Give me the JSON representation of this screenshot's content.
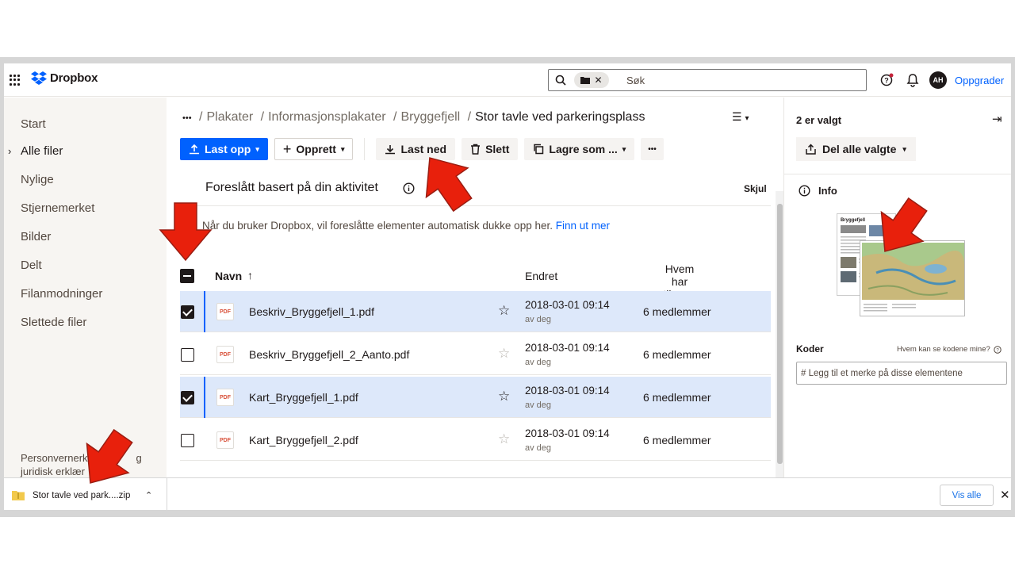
{
  "app": {
    "name": "Dropbox"
  },
  "header": {
    "search_placeholder": "Søk",
    "avatar_initials": "AH",
    "upgrade_label": "Oppgrader"
  },
  "sidebar": {
    "items": [
      {
        "label": "Start"
      },
      {
        "label": "Alle filer",
        "active": true
      },
      {
        "label": "Nylige"
      },
      {
        "label": "Stjernemerket"
      },
      {
        "label": "Bilder"
      },
      {
        "label": "Delt"
      },
      {
        "label": "Filanmodninger"
      },
      {
        "label": "Slettede filer"
      }
    ],
    "legal_line1": "Personvernerkl",
    "legal_line1_tail": "g",
    "legal_line2": "juridisk erklær"
  },
  "breadcrumb": {
    "more": "•••",
    "parts": [
      "Plakater",
      "Informasjonsplakater",
      "Bryggefjell"
    ],
    "current": "Stor tavle ved parkeringsplass"
  },
  "toolbar": {
    "upload_label": "Last opp",
    "create_label": "Opprett",
    "download_label": "Last ned",
    "delete_label": "Slett",
    "save_as_label": "Lagre som ...",
    "more_label": "•••"
  },
  "suggestions": {
    "title": "Foreslått basert på din aktivitet",
    "hide_label": "Skjul",
    "text": "Når du bruker Dropbox, vil foreslåtte elementer automatisk dukke opp her.",
    "link": "Finn ut mer"
  },
  "table": {
    "columns": {
      "name": "Navn",
      "modified": "Endret",
      "access_line1": "Hvem har",
      "access_line2": "tilgang"
    },
    "rows": [
      {
        "name": "Beskriv_Bryggefjell_1.pdf",
        "modified": "2018-03-01 09:14",
        "by": "av deg",
        "members": "6 medlemmer",
        "selected": true,
        "starred": true
      },
      {
        "name": "Beskriv_Bryggefjell_2_Aanto.pdf",
        "modified": "2018-03-01 09:14",
        "by": "av deg",
        "members": "6 medlemmer",
        "selected": false,
        "starred": false
      },
      {
        "name": "Kart_Bryggefjell_1.pdf",
        "modified": "2018-03-01 09:14",
        "by": "av deg",
        "members": "6 medlemmer",
        "selected": true,
        "starred": true
      },
      {
        "name": "Kart_Bryggefjell_2.pdf",
        "modified": "2018-03-01 09:14",
        "by": "av deg",
        "members": "6 medlemmer",
        "selected": false,
        "starred": false
      }
    ],
    "file_badge": "PDF"
  },
  "panel": {
    "title": "2 er valgt",
    "share_label": "Del alle valgte",
    "info_label": "Info",
    "thumb_title": "Bryggefjell",
    "tags_label": "Koder",
    "tags_help": "Hvem kan se kodene mine?",
    "tags_placeholder": "# Legg til et merke på disse elementene"
  },
  "downloads": {
    "file": "Stor tavle ved park....zip",
    "show_all": "Vis alle"
  },
  "colors": {
    "accent": "#0061fe",
    "selected_row": "#dde8fa",
    "arrow": "#e8200c"
  }
}
